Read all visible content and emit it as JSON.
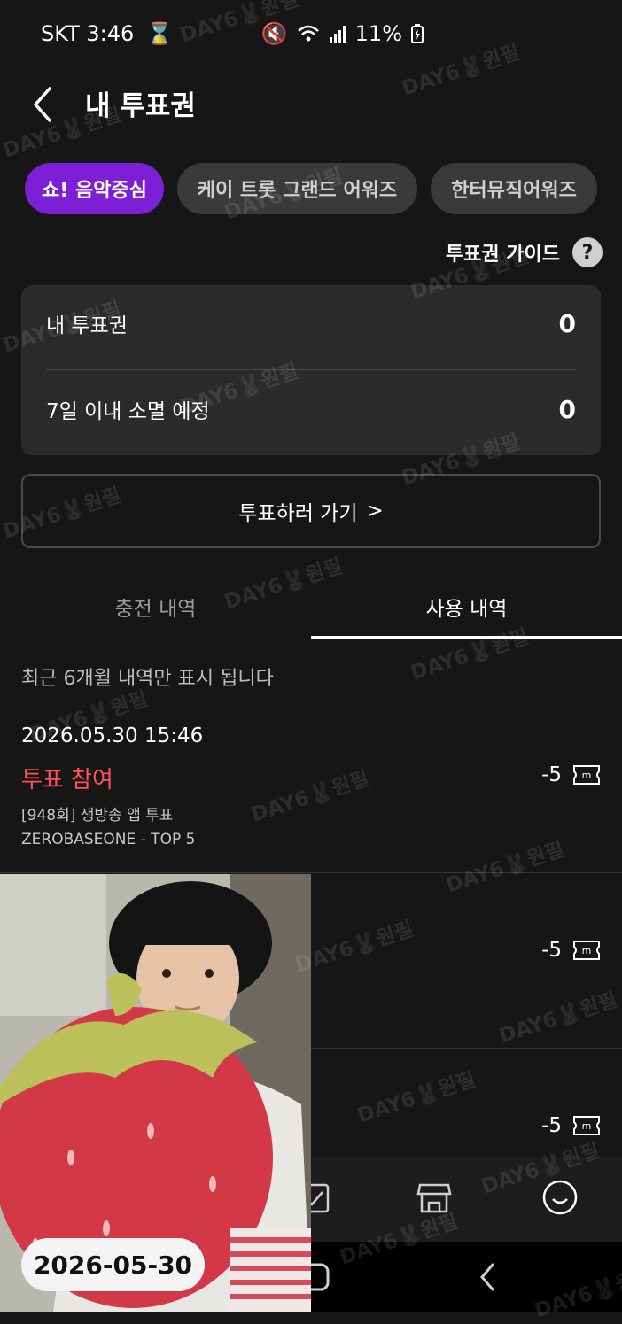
{
  "status_bar": {
    "carrier_time": "SKT 3:46",
    "battery": "11%",
    "icons": [
      "hourglass-icon",
      "mute-icon",
      "wifi-icon",
      "signal-icon",
      "battery-charging-icon"
    ]
  },
  "header": {
    "title": "내 투표권",
    "back_icon": "back-arrow-icon"
  },
  "chips": [
    {
      "label": "쇼! 음악중심",
      "active": true
    },
    {
      "label": "케이 트롯 그랜드 어워즈",
      "active": false
    },
    {
      "label": "한터뮤직어워즈",
      "active": false
    }
  ],
  "guide": {
    "label": "투표권 가이드",
    "icon": "question-icon"
  },
  "balance": {
    "my_votes_label": "내 투표권",
    "my_votes_value": "0",
    "expiring_label": "7일 이내 소멸 예정",
    "expiring_value": "0"
  },
  "vote_button": {
    "label": "투표하러 가기",
    "chevron": ">"
  },
  "tabs": {
    "charge": "충전 내역",
    "usage": "사용 내역",
    "selected": "usage"
  },
  "notice": "최근 6개월 내역만 표시 됩니다",
  "entries": [
    {
      "date": "2026.05.30 15:46",
      "type": "투표 참여",
      "detail": "[948회] 생방송 앱 투표",
      "subject": "ZEROBASEONE - TOP 5",
      "amount": "-5"
    },
    {
      "amount": "-5"
    },
    {
      "amount": "-5"
    }
  ],
  "photo_overlay": {
    "date": "2026-05-30"
  },
  "watermark": "DAY6🐰원필",
  "colors": {
    "background": "#161616",
    "accent": "#7c1fd6",
    "vote_red": "#ff4f5a",
    "card": "#2b2b2d"
  }
}
